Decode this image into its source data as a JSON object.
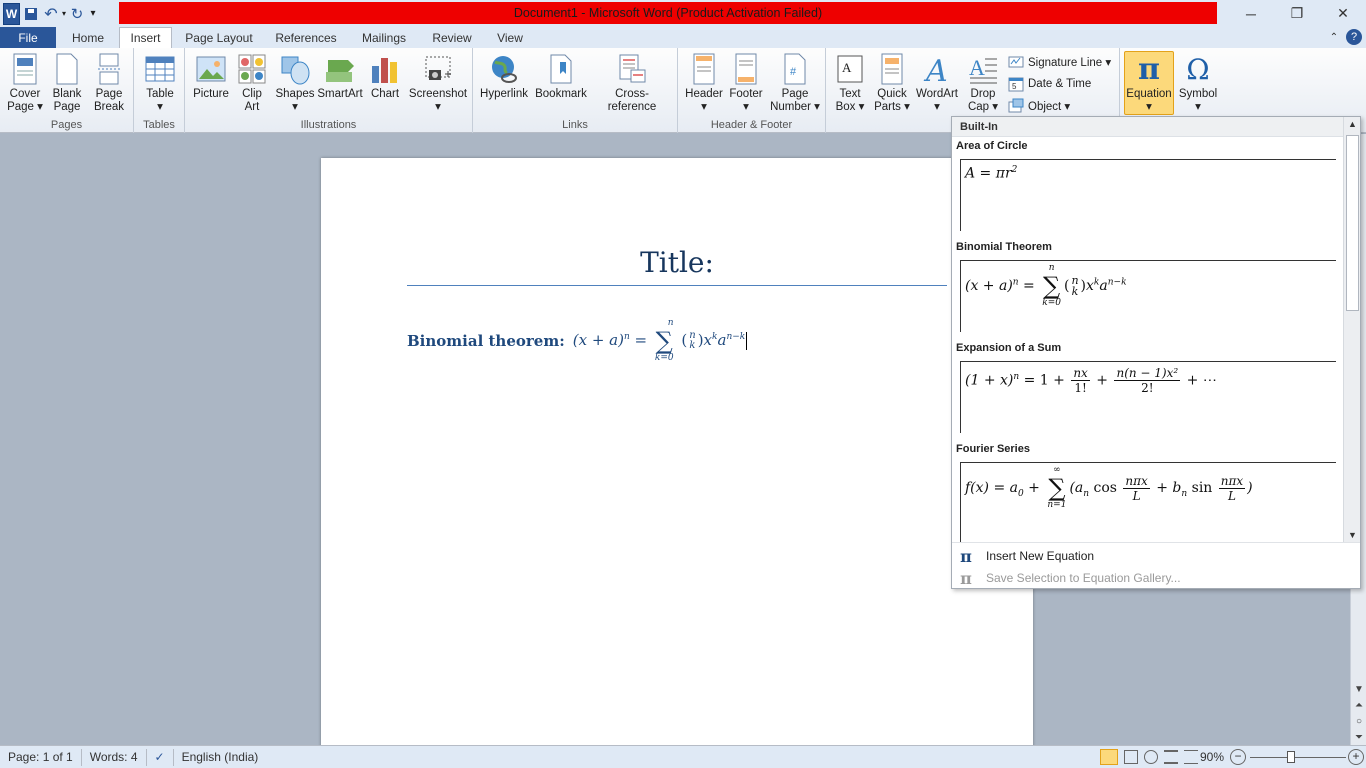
{
  "window": {
    "title": "Document1  -  Microsoft Word (Product Activation Failed)",
    "app_icon": "W",
    "min": "─",
    "restore": "❐",
    "close": "✕"
  },
  "qat": {
    "save_icon": "▪",
    "undo_icon": "↶",
    "redo_icon": "↻",
    "customize_icon": "▾"
  },
  "tabs": {
    "file": "File",
    "home": "Home",
    "insert": "Insert",
    "page_layout": "Page Layout",
    "references": "References",
    "mailings": "Mailings",
    "review": "Review",
    "view": "View"
  },
  "ribbon": {
    "pages": {
      "label": "Pages",
      "cover": "Cover\nPage ▾",
      "blank": "Blank\nPage",
      "break": "Page\nBreak"
    },
    "tables": {
      "label": "Tables",
      "table": "Table\n▾"
    },
    "illustrations": {
      "label": "Illustrations",
      "picture": "Picture",
      "clipart": "Clip\nArt",
      "shapes": "Shapes\n▾",
      "smartart": "SmartArt",
      "chart": "Chart",
      "screenshot": "Screenshot\n▾"
    },
    "links": {
      "label": "Links",
      "hyperlink": "Hyperlink",
      "bookmark": "Bookmark",
      "crossref": "Cross-reference"
    },
    "header_footer": {
      "label": "Header & Footer",
      "header": "Header\n▾",
      "footer": "Footer\n▾",
      "page_number": "Page\nNumber ▾"
    },
    "text": {
      "textbox": "Text\nBox ▾",
      "quickparts": "Quick\nParts ▾",
      "wordart": "WordArt\n▾",
      "dropcap": "Drop\nCap ▾",
      "signature": "Signature Line ▾",
      "datetime": "Date & Time",
      "object": "Object ▾"
    },
    "symbols": {
      "equation": "Equation\n▾",
      "symbol": "Symbol\n▾"
    }
  },
  "document": {
    "title": "Title:",
    "label": "Binomial theorem:",
    "eq_lhs": "(x + a)",
    "eq_lhs_sup": "n",
    "eq_eq": " = ",
    "eq_sum_top": "n",
    "eq_sum_sym": "∑",
    "eq_sum_bot": "k=0",
    "eq_binom_top": "n",
    "eq_binom_bot": "k",
    "eq_x": "x",
    "eq_x_sup": "k",
    "eq_a": "a",
    "eq_a_sup": "n−k"
  },
  "gallery": {
    "header": "Built-In",
    "items": [
      {
        "title": "Area of Circle"
      },
      {
        "title": "Binomial Theorem"
      },
      {
        "title": "Expansion of a Sum"
      },
      {
        "title": "Fourier Series"
      }
    ],
    "eq_area": "A = πr",
    "eq_area_sup": "2",
    "eq_binom_lhs": "(x + a)",
    "eq_binom_sup": "n",
    "eq_binom_rest": "x",
    "eq_binom_xk": "k",
    "eq_binom_a": "a",
    "eq_binom_ank": "n−k",
    "eq_exp_lhs": "(1 + x)",
    "eq_exp_sup": "n",
    "eq_exp_eq": " = 1 + ",
    "eq_exp_f1_num": "nx",
    "eq_exp_f1_den": "1!",
    "eq_exp_plus": " + ",
    "eq_exp_f2_num": "n(n − 1)x²",
    "eq_exp_f2_den": "2!",
    "eq_exp_tail": " + ⋯",
    "eq_fourier_lhs": "f(x) = a",
    "eq_fourier_a0sub": "0",
    "eq_fourier_plus": " + ",
    "eq_fourier_top": "∞",
    "eq_fourier_bot": "n=1",
    "eq_fourier_open": "(a",
    "eq_fourier_an_sub": "n",
    "eq_fourier_cos": " cos ",
    "eq_fourier_frac_num": "nπx",
    "eq_fourier_frac_den": "L",
    "eq_fourier_b": " + b",
    "eq_fourier_bn_sub": "n",
    "eq_fourier_sin": " sin ",
    "eq_fourier_close": ")",
    "insert_new": "Insert New Equation",
    "save_selection": "Save Selection to Equation Gallery...",
    "pi_icon": "π"
  },
  "status": {
    "page": "Page: 1 of 1",
    "words": "Words: 4",
    "language": "English (India)",
    "zoom": "90%",
    "zoom_minus": "−",
    "zoom_plus": "+"
  },
  "colors": {
    "accent": "#2a5699",
    "title_bar_red": "#ee0000",
    "heading": "#1f497d"
  }
}
